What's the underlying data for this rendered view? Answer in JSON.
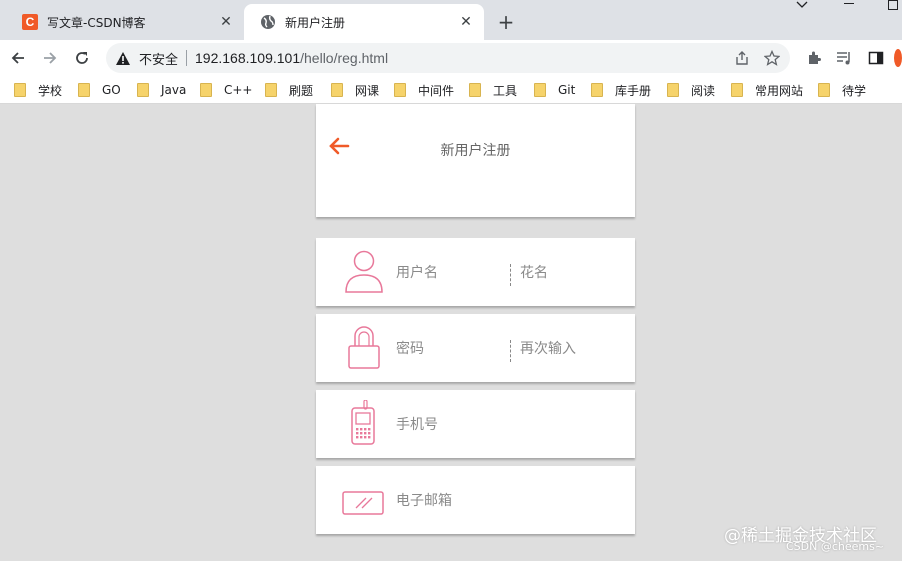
{
  "tabs": [
    {
      "title": "写文章-CSDN博客",
      "icon": "csdn-logo-icon",
      "icon_text": "C"
    },
    {
      "title": "新用户注册",
      "icon": "globe-icon"
    }
  ],
  "window_controls": {
    "dropdown": "⌄",
    "minimize": "—",
    "maximize": "☐"
  },
  "new_tab": "+",
  "address": {
    "security_label": "不安全",
    "host": "192.168.109.101",
    "path": "/hello/reg.html"
  },
  "bookmarks": [
    "学校",
    "GO",
    "Java",
    "C++",
    "刷题",
    "网课",
    "中间件",
    "工具",
    "Git",
    "库手册",
    "阅读",
    "常用网站",
    "待学"
  ],
  "page": {
    "title": "新用户注册",
    "rows": [
      {
        "icon": "user-icon",
        "left_placeholder": "用户名",
        "right_placeholder": "花名"
      },
      {
        "icon": "lock-icon",
        "left_placeholder": "密码",
        "right_placeholder": "再次输入"
      },
      {
        "icon": "mobile-phone-icon",
        "left_placeholder": "手机号"
      },
      {
        "icon": "email-card-icon",
        "left_placeholder": "电子邮箱"
      }
    ]
  },
  "watermark": {
    "line1": "@稀土掘金技术社区",
    "line2": "CSDN @cheems~"
  },
  "colors": {
    "accent": "#f05a28",
    "icon_pink": "#e8789a",
    "csdn_red": "#f05a28"
  }
}
